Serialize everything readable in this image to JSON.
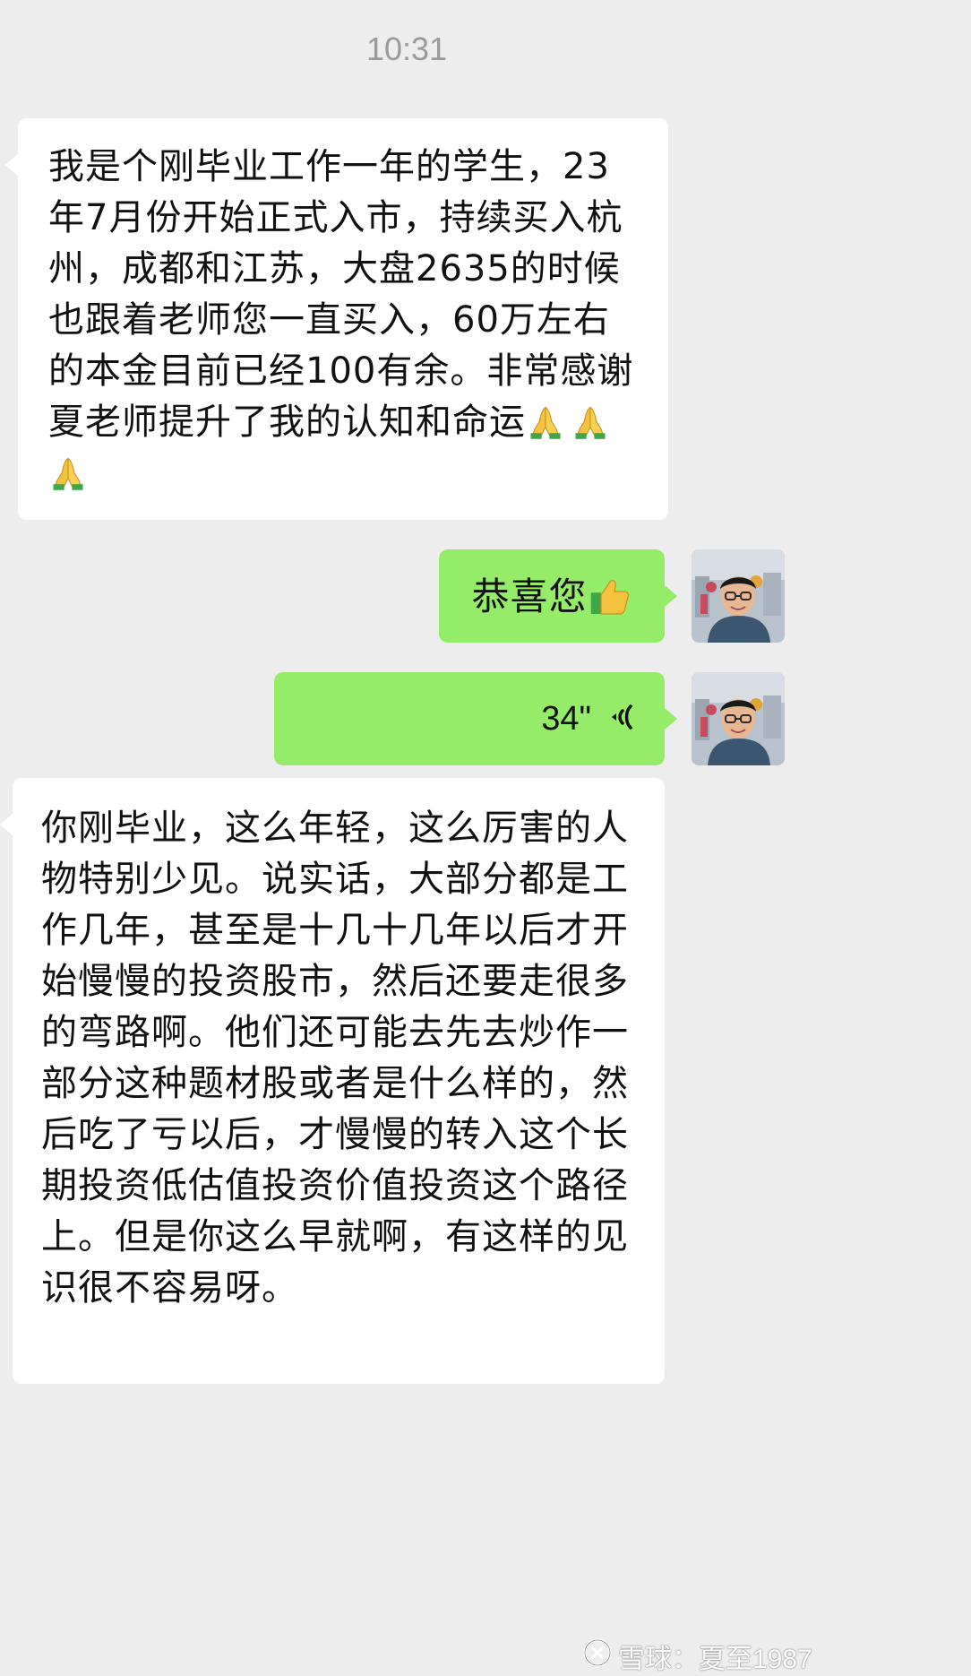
{
  "status": {
    "time": "10:31"
  },
  "messages": [
    {
      "side": "in",
      "text": "我是个刚毕业工作一年的学生，23年7月份开始正式入市，持续买入杭州，成都和江苏，大盘2635的时候也跟着老师您一直买入，60万左右的本金目前已经100有余。非常感谢夏老师提升了我的认知和命运",
      "emoji": "folded-hands-icon"
    },
    {
      "side": "out",
      "text": "恭喜您",
      "emoji": "thumbs-up-icon"
    },
    {
      "side": "out",
      "type": "voice",
      "duration": "34\""
    },
    {
      "side": "in",
      "text": "你刚毕业，这么年轻，这么厉害的人物特别少见。说实话，大部分都是工作几年，甚至是十几十几年以后才开始慢慢的投资股市，然后还要走很多的弯路啊。他们还可能去先去炒作一部分这种题材股或者是什么样的，然后吃了亏以后，才慢慢的转入这个长期投资低估值投资价值投资这个路径上。但是你这么早就啊，有这样的见识很不容易呀。"
    }
  ],
  "watermark": {
    "text": "雪球：夏至1987"
  },
  "colors": {
    "background": "#ededed",
    "incoming_bubble": "#ffffff",
    "outgoing_bubble": "#95ec69"
  }
}
